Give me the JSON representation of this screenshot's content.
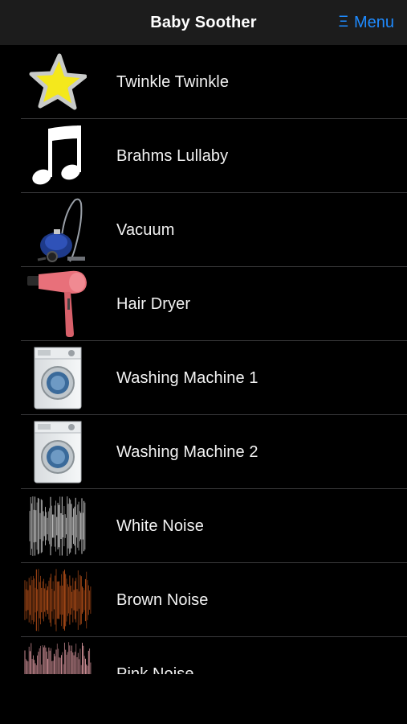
{
  "header": {
    "title": "Baby Soother",
    "menu_label": "Menu",
    "menu_icon": "Ξ"
  },
  "sounds": [
    {
      "label": "Twinkle Twinkle",
      "icon": "star-icon"
    },
    {
      "label": "Brahms Lullaby",
      "icon": "music-note-icon"
    },
    {
      "label": "Vacuum",
      "icon": "vacuum-icon"
    },
    {
      "label": "Hair Dryer",
      "icon": "hair-dryer-icon"
    },
    {
      "label": "Washing Machine 1",
      "icon": "washing-machine-icon"
    },
    {
      "label": "Washing Machine 2",
      "icon": "washing-machine-icon"
    },
    {
      "label": "White Noise",
      "icon": "white-noise-icon"
    },
    {
      "label": "Brown Noise",
      "icon": "brown-noise-icon"
    },
    {
      "label": "Pink Noise",
      "icon": "pink-noise-icon"
    }
  ],
  "colors": {
    "accent": "#1e8bff",
    "background": "#000000",
    "navbar": "#1c1c1c",
    "separator": "#3a3a3c",
    "white_noise": "#e8e8e8",
    "brown_noise": "#c8581c",
    "pink_noise": "#e8a0a8"
  }
}
